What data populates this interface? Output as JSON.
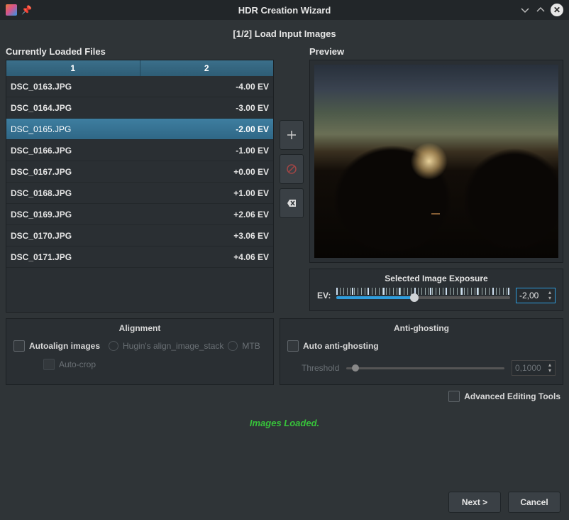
{
  "window": {
    "title": "HDR Creation Wizard"
  },
  "step_label": "[1/2] Load Input Images",
  "loaded_label": "Currently Loaded Files",
  "preview_label": "Preview",
  "table": {
    "col1": "1",
    "col2": "2",
    "rows": [
      {
        "filename": "DSC_0163.JPG",
        "ev": "-4.00 EV",
        "selected": false
      },
      {
        "filename": "DSC_0164.JPG",
        "ev": "-3.00 EV",
        "selected": false
      },
      {
        "filename": "DSC_0165.JPG",
        "ev": "-2.00 EV",
        "selected": true
      },
      {
        "filename": "DSC_0166.JPG",
        "ev": "-1.00 EV",
        "selected": false
      },
      {
        "filename": "DSC_0167.JPG",
        "ev": "+0.00 EV",
        "selected": false
      },
      {
        "filename": "DSC_0168.JPG",
        "ev": "+1.00 EV",
        "selected": false
      },
      {
        "filename": "DSC_0169.JPG",
        "ev": "+2.06 EV",
        "selected": false
      },
      {
        "filename": "DSC_0170.JPG",
        "ev": "+3.06 EV",
        "selected": false
      },
      {
        "filename": "DSC_0171.JPG",
        "ev": "+4.06 EV",
        "selected": false
      }
    ]
  },
  "exposure": {
    "panel_title": "Selected Image Exposure",
    "label": "EV:",
    "value": "-2,00",
    "fill_pct": 45,
    "thumb_pct": 45
  },
  "alignment": {
    "title": "Alignment",
    "autoalign_label": "Autoalign images",
    "hugin_label": "Hugin's align_image_stack",
    "mtb_label": "MTB",
    "autocrop_label": "Auto-crop"
  },
  "ghosting": {
    "title": "Anti-ghosting",
    "auto_label": "Auto anti-ghosting",
    "threshold_label": "Threshold",
    "threshold_value": "0,1000"
  },
  "advanced_label": "Advanced Editing Tools",
  "status": "Images Loaded.",
  "buttons": {
    "next": "Next >",
    "cancel": "Cancel"
  }
}
